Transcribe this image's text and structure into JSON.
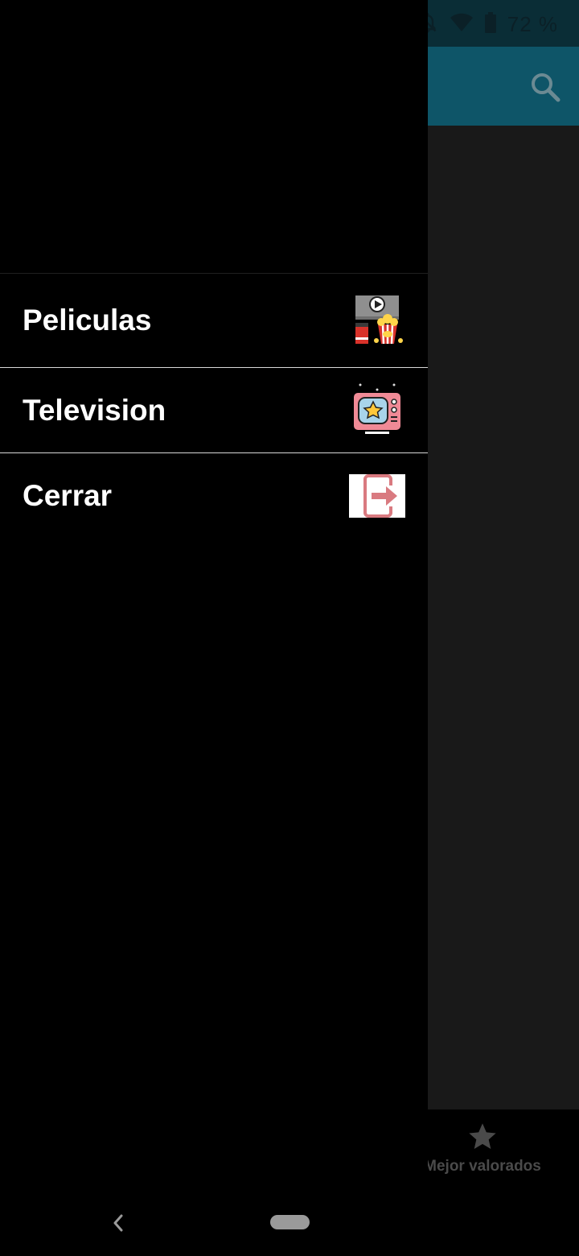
{
  "status_bar": {
    "battery": "72 %"
  },
  "bottom_nav": {
    "top_rated_label": "Mejor valorados"
  },
  "drawer": {
    "items": [
      {
        "label": "Peliculas",
        "icon": "movies-icon"
      },
      {
        "label": "Television",
        "icon": "television-icon"
      },
      {
        "label": "Cerrar",
        "icon": "logout-icon"
      }
    ]
  },
  "colors": {
    "status_bar": "#0a2d36",
    "toolbar": "#0e5568",
    "content": "#191919",
    "drawer": "#000000"
  }
}
